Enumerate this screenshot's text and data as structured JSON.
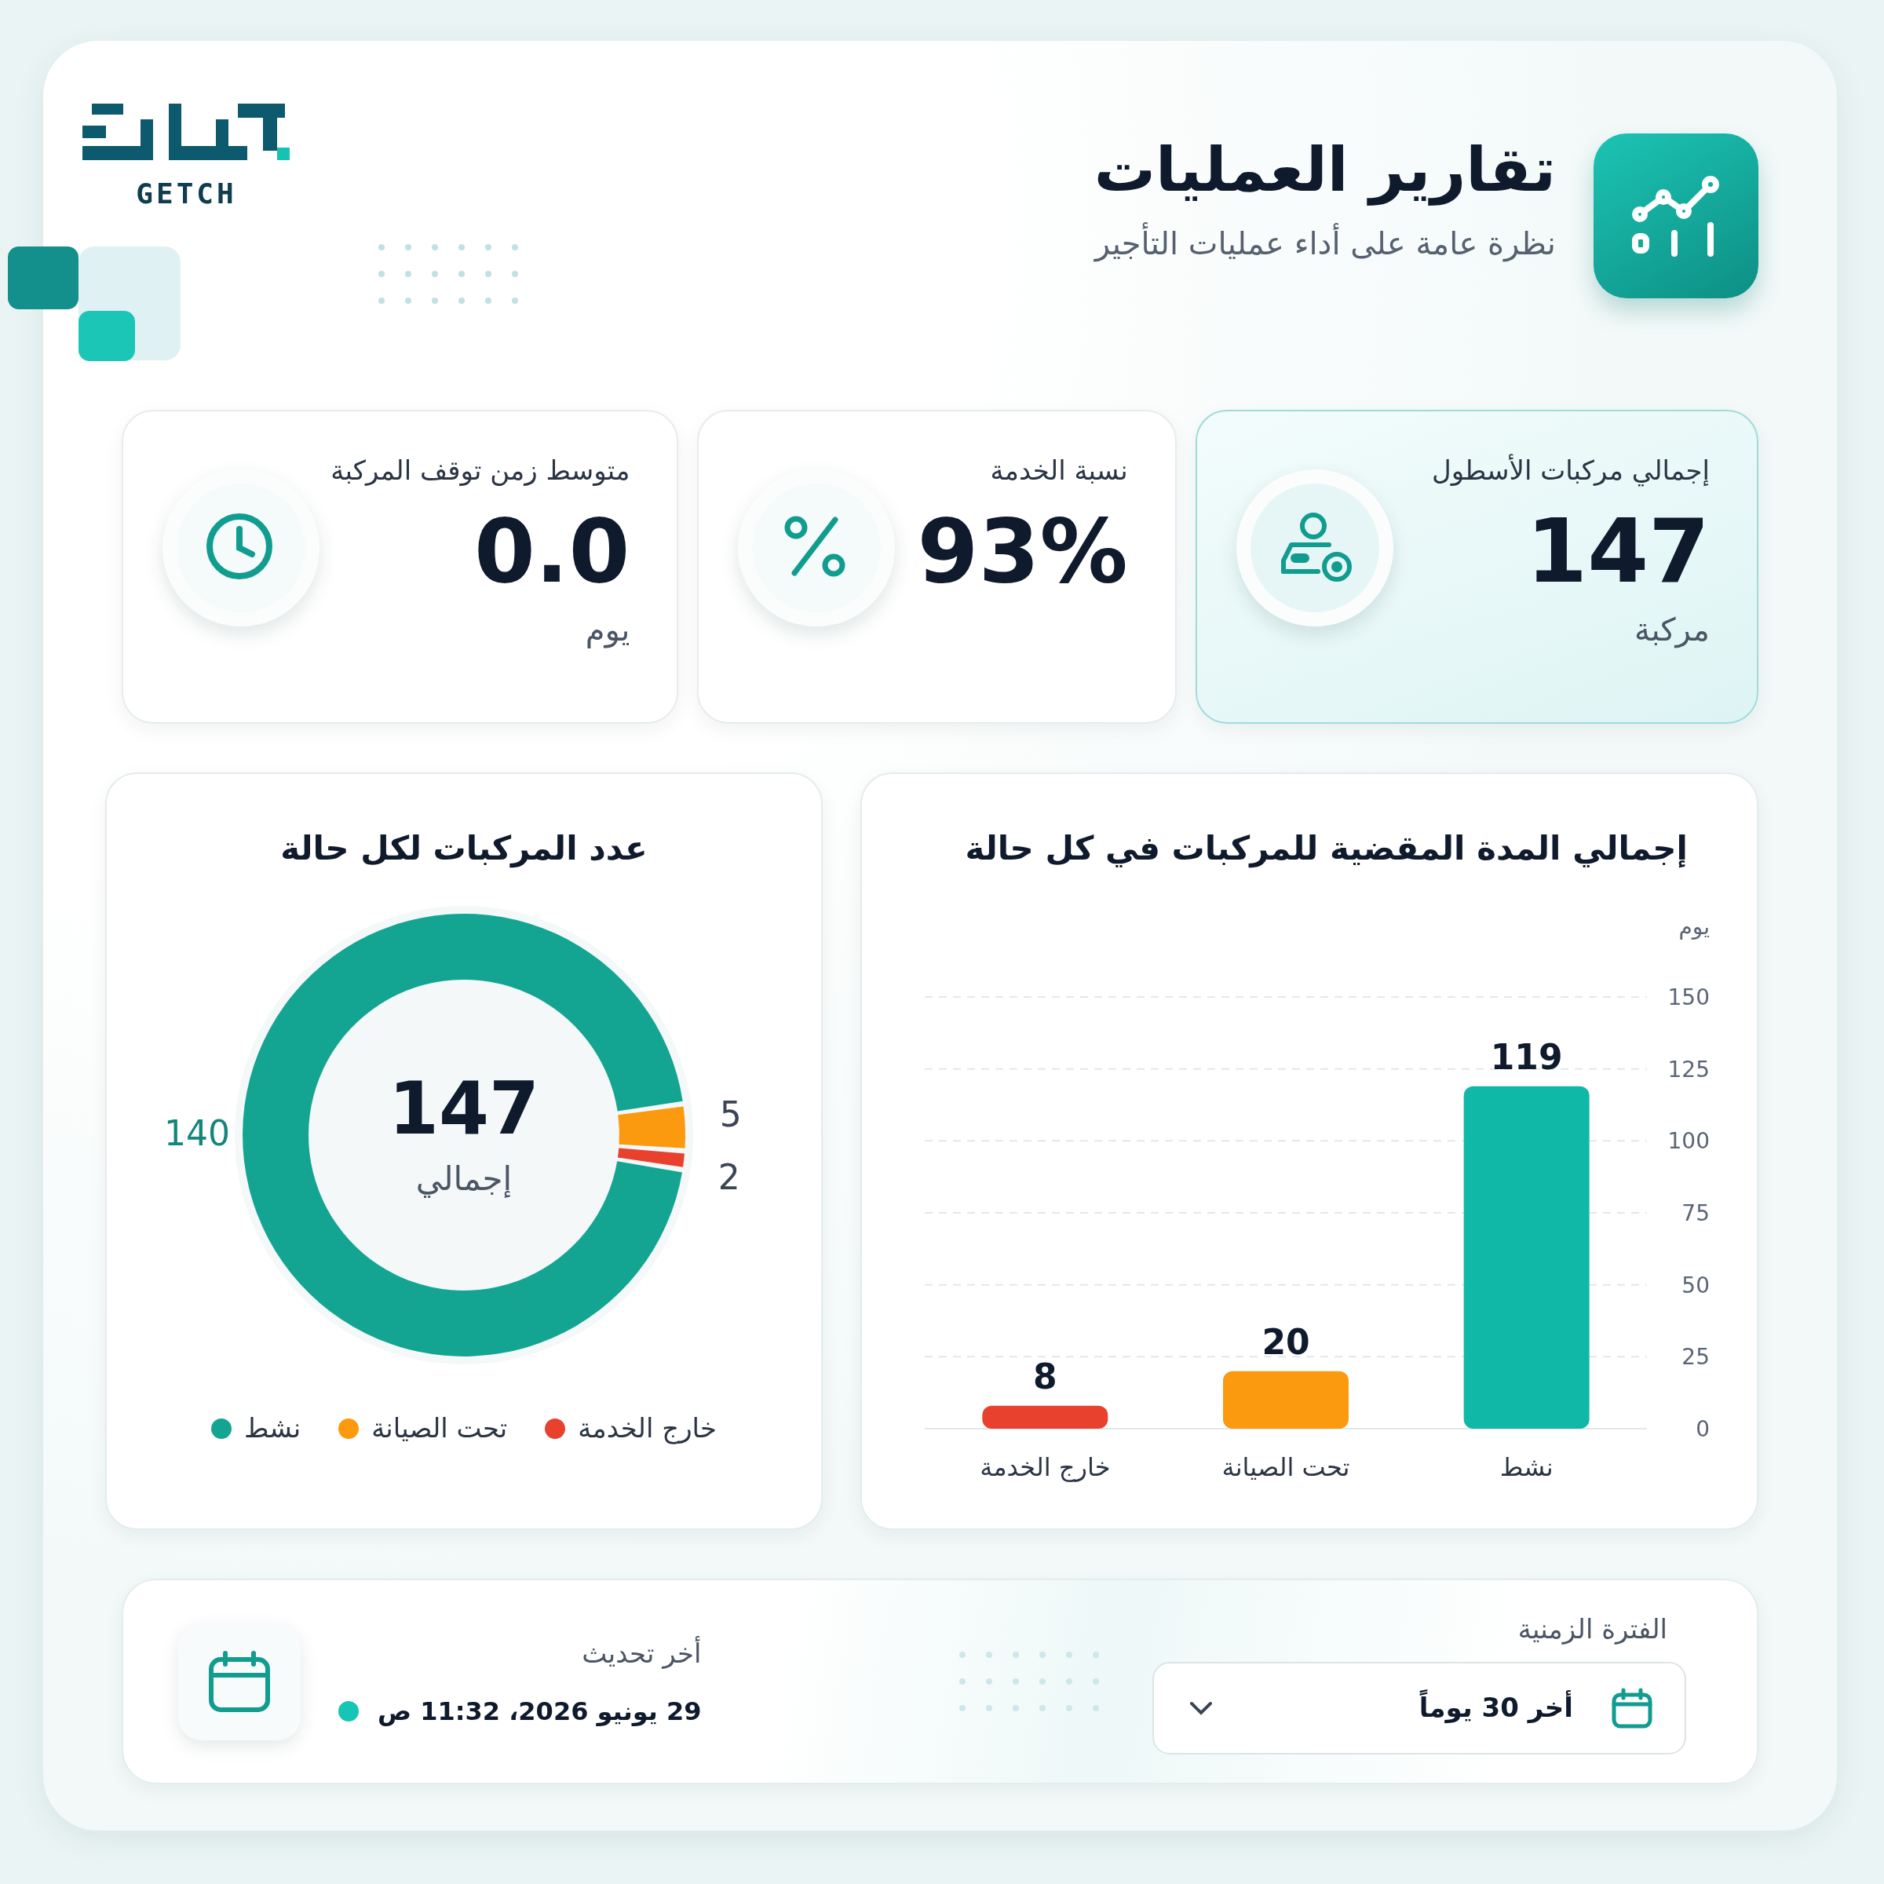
{
  "brand": {
    "name": "GETCH"
  },
  "header": {
    "title": "تقارير العمليات",
    "subtitle": "نظرة عامة على أداء عمليات التأجير"
  },
  "stats": [
    {
      "kind": "fleet",
      "label": "إجمالي مركبات الأسطول",
      "value": "147",
      "unit": "مركبة",
      "selected": true
    },
    {
      "kind": "service",
      "label": "نسبة الخدمة",
      "value": "93%",
      "selected": false
    },
    {
      "kind": "downtime",
      "label": "متوسط زمن توقف المركبة",
      "value": "0.0",
      "unit": "يوم",
      "selected": false
    }
  ],
  "bar_card": {
    "title": "إجمالي المدة المقضية للمركبات في كل حالة",
    "chart_data": {
      "type": "bar",
      "ylabel": "يوم",
      "categories": [
        "خارج الخدمة",
        "تحت الصيانة",
        "نشط"
      ],
      "values": [
        8,
        20,
        119
      ],
      "colors": [
        "#e8412e",
        "#fb9a0e",
        "#10b8a8"
      ],
      "ylim": [
        0,
        150
      ],
      "yticks": [
        0,
        25,
        50,
        75,
        100,
        125,
        150
      ],
      "grid": true,
      "data_labels": true
    }
  },
  "donut_card": {
    "title": "عدد المركبات لكل حالة",
    "center_value": "147",
    "center_label": "إجمالي",
    "chart_data": {
      "type": "donut",
      "categories": [
        "نشط",
        "تحت الصيانة",
        "خارج الخدمة"
      ],
      "values": [
        140,
        5,
        2
      ],
      "colors": [
        "#13a592",
        "#fb9a0e",
        "#e8412e"
      ],
      "data_labels": true
    },
    "legend": true
  },
  "footer": {
    "period_label": "الفترة الزمنية",
    "period_value": "أخر 30 يوماً",
    "update_label": "أخر تحديث",
    "update_value": "29 يونيو 2026، 11:32 ص"
  }
}
